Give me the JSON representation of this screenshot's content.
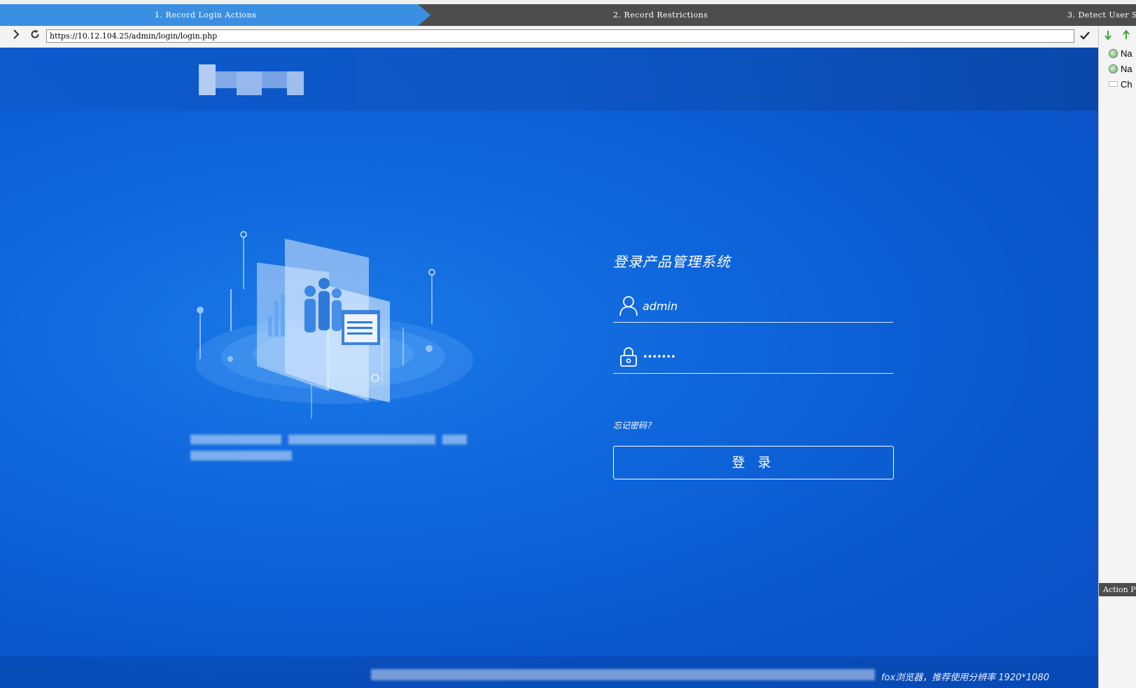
{
  "wizard": {
    "steps": [
      {
        "label": "1. Record Login Actions",
        "active": true
      },
      {
        "label": "2. Record Restrictions",
        "active": false
      },
      {
        "label": "3. Detect User S",
        "active": false
      }
    ],
    "active_color": "#3b8fe2",
    "bar_color": "#4d4d4d"
  },
  "browser": {
    "url": "https://10.12.104.25/admin/login/login.php",
    "forward_icon": "chevron-right-icon",
    "reload_icon": "reload-icon",
    "go_icon": "check-icon"
  },
  "recorder_panel": {
    "toolbar": [
      "arrow-down-icon",
      "arrow-up-icon"
    ],
    "items": [
      {
        "label": "Na",
        "icon": "navigate-icon"
      },
      {
        "label": "Na",
        "icon": "navigate-icon"
      },
      {
        "label": "Ch",
        "icon": "checkbox-icon"
      }
    ],
    "action_pane_title": "Action P"
  },
  "login_page": {
    "title": "登录产品管理系统",
    "username_value": "admin",
    "password_value": "•••••••",
    "forgot_link": "忘记密码？",
    "login_button": "登 录",
    "footer_visible_text": "fox浏览器，推荐使用分辨率 1920*1080",
    "colors": {
      "background": "#0f66dc",
      "accent": "#ffffff"
    }
  }
}
